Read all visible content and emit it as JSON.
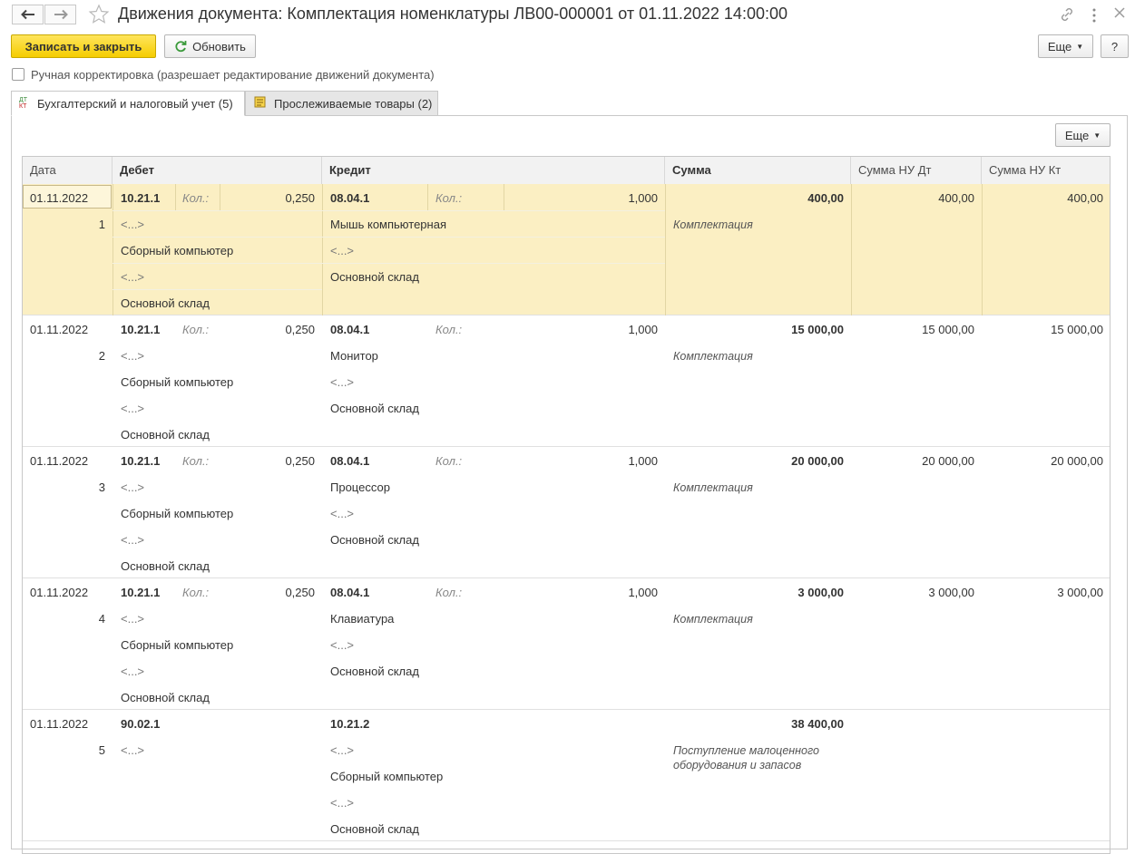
{
  "window": {
    "title": "Движения документа: Комплектация номенклатуры ЛВ00-000001 от 01.11.2022 14:00:00",
    "back_icon": "arrow-left-icon",
    "forward_icon": "arrow-right-icon",
    "favorite_icon": "star-icon",
    "link_icon": "link-icon",
    "menu_icon": "vertical-dots-icon",
    "close_icon": "close-icon"
  },
  "toolbar": {
    "save_close_label": "Записать и закрыть",
    "refresh_label": "Обновить",
    "more_label": "Еще",
    "help_label": "?"
  },
  "manual_adjustment": {
    "label": "Ручная корректировка (разрешает редактирование движений документа)",
    "checked": false
  },
  "tabs": [
    {
      "label": "Бухгалтерский и налоговый учет (5)",
      "active": true
    },
    {
      "label": "Прослеживаемые товары (2)",
      "active": false
    }
  ],
  "table_more_label": "Еще",
  "columns": [
    "Дата",
    "Дебет",
    "Кредит",
    "Сумма",
    "Сумма НУ Дт",
    "Сумма НУ Кт"
  ],
  "qty_label": "Кол.:",
  "rows": [
    {
      "date": "01.11.2022",
      "num": "1",
      "dt_account": "10.21.1",
      "dt_qty": "0,250",
      "dt_lines": [
        "<...>",
        "Сборный компьютер",
        "<...>",
        "Основной склад"
      ],
      "kt_account": "08.04.1",
      "kt_qty": "1,000",
      "kt_lines": [
        "Мышь компьютерная",
        "<...>",
        "Основной склад"
      ],
      "sum": "400,00",
      "note": "Комплектация",
      "nu_dt": "400,00",
      "nu_kt": "400,00"
    },
    {
      "date": "01.11.2022",
      "num": "2",
      "dt_account": "10.21.1",
      "dt_qty": "0,250",
      "dt_lines": [
        "<...>",
        "Сборный компьютер",
        "<...>",
        "Основной склад"
      ],
      "kt_account": "08.04.1",
      "kt_qty": "1,000",
      "kt_lines": [
        "Монитор",
        "<...>",
        "Основной склад"
      ],
      "sum": "15 000,00",
      "note": "Комплектация",
      "nu_dt": "15 000,00",
      "nu_kt": "15 000,00"
    },
    {
      "date": "01.11.2022",
      "num": "3",
      "dt_account": "10.21.1",
      "dt_qty": "0,250",
      "dt_lines": [
        "<...>",
        "Сборный компьютер",
        "<...>",
        "Основной склад"
      ],
      "kt_account": "08.04.1",
      "kt_qty": "1,000",
      "kt_lines": [
        "Процессор",
        "<...>",
        "Основной склад"
      ],
      "sum": "20 000,00",
      "note": "Комплектация",
      "nu_dt": "20 000,00",
      "nu_kt": "20 000,00"
    },
    {
      "date": "01.11.2022",
      "num": "4",
      "dt_account": "10.21.1",
      "dt_qty": "0,250",
      "dt_lines": [
        "<...>",
        "Сборный компьютер",
        "<...>",
        "Основной склад"
      ],
      "kt_account": "08.04.1",
      "kt_qty": "1,000",
      "kt_lines": [
        "Клавиатура",
        "<...>",
        "Основной склад"
      ],
      "sum": "3 000,00",
      "note": "Комплектация",
      "nu_dt": "3 000,00",
      "nu_kt": "3 000,00"
    },
    {
      "date": "01.11.2022",
      "num": "5",
      "dt_account": "90.02.1",
      "dt_qty": "",
      "dt_lines": [
        "<...>"
      ],
      "kt_account": "10.21.2",
      "kt_qty": "",
      "kt_lines": [
        "<...>",
        "Сборный компьютер",
        "<...>",
        "Основной склад"
      ],
      "sum": "38 400,00",
      "note": "Поступление малоценного оборудования и запасов",
      "nu_dt": "",
      "nu_kt": ""
    }
  ]
}
